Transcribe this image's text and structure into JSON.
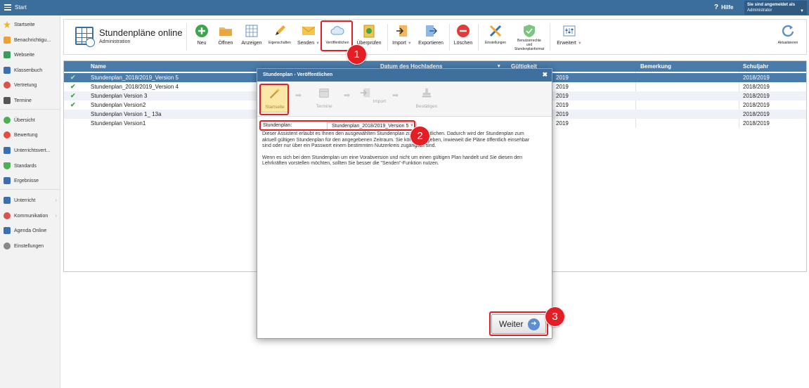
{
  "topbar": {
    "title": "Start",
    "help": "Hilfe",
    "user_line1": "Sie sind angemeldet als",
    "user_line2": "Administrator"
  },
  "sidebar": {
    "items": [
      {
        "label": "Startseite",
        "icon": "star-icon",
        "color": "#f0b429"
      },
      {
        "label": "Benachrichtigu...",
        "icon": "mail-icon",
        "color": "#f0a030"
      },
      {
        "label": "Webseite",
        "icon": "home-icon",
        "color": "#3a9a5c"
      },
      {
        "label": "Klassenbuch",
        "icon": "book-icon",
        "color": "#3a6fb0"
      },
      {
        "label": "Vertretung",
        "icon": "person-icon",
        "color": "#d9534f"
      },
      {
        "label": "Termine",
        "icon": "calendar-icon",
        "color": "#555"
      },
      {
        "label": "Übersicht",
        "icon": "check-circle-icon",
        "color": "#4caf50"
      },
      {
        "label": "Bewertung",
        "icon": "rating-icon",
        "color": "#e74c3c"
      },
      {
        "label": "Unterrichtsvert...",
        "icon": "list-icon",
        "color": "#3a6fb0"
      },
      {
        "label": "Standards",
        "icon": "shield-icon",
        "color": "#4caf50"
      },
      {
        "label": "Ergebnisse",
        "icon": "bar-chart-icon",
        "color": "#3a6fb0"
      },
      {
        "label": "Unterricht",
        "icon": "briefcase-icon",
        "color": "#3a6fb0"
      },
      {
        "label": "Kommunikation",
        "icon": "chat-icon",
        "color": "#d9534f"
      },
      {
        "label": "Agenda Online",
        "icon": "pen-icon",
        "color": "#3a6fb0"
      },
      {
        "label": "Einstellungen",
        "icon": "gear-icon",
        "color": "#888"
      }
    ]
  },
  "toolbar": {
    "app_title": "Stundenpläne online",
    "app_subtitle": "Administration",
    "neu": "Neu",
    "oeffnen": "Öffnen",
    "anzeigen": "Anzeigen",
    "eigenschaften": "Eigenschaften",
    "senden": "Senden",
    "veroeffentlichen": "Veröffentlichen",
    "ueberpruefen": "Überprüfen",
    "import": "Import",
    "exportieren": "Exportieren",
    "loeschen": "Löschen",
    "einstellungen": "Einstellungen",
    "benutzerrechte_1": "Benutzerrechte",
    "benutzerrechte_2": "und",
    "benutzerrechte_3": "Stundenplanformat",
    "erweitert": "Erweitert",
    "aktualisieren": "Aktualisieren"
  },
  "table": {
    "headers": {
      "name": "Name",
      "datum": "Datum des Hochladens",
      "gueltigkeit": "Gültigkeit",
      "bemerkung": "Bemerkung",
      "schuljahr": "Schuljahr"
    },
    "rows": [
      {
        "name": "Stundenplan_2018/2019_Version 5",
        "gueltigkeit": "2019",
        "schuljahr": "2018/2019",
        "checked": true
      },
      {
        "name": "Stundenplan_2018/2019_Version 4",
        "gueltigkeit": "2019",
        "schuljahr": "2018/2019",
        "checked": true
      },
      {
        "name": "Stundenplan Version 3",
        "gueltigkeit": "2019",
        "schuljahr": "2018/2019",
        "checked": true
      },
      {
        "name": "Stundenplan Version2",
        "gueltigkeit": "2019",
        "schuljahr": "2018/2019",
        "checked": true
      },
      {
        "name": "Stundenplan Version 1_ 13a",
        "gueltigkeit": "2019",
        "schuljahr": "2018/2019",
        "checked": false
      },
      {
        "name": "Stundenplan Version1",
        "gueltigkeit": "2019",
        "schuljahr": "2018/2019",
        "checked": false
      }
    ]
  },
  "modal": {
    "title": "Stundenplan - Veröffentlichen",
    "close": "✖",
    "steps": [
      "Startseite",
      "Termine",
      "Import",
      "Bestätigen"
    ],
    "field_label": "Stundenplan:",
    "field_value": "Stundenplan_2018/2019_Version 5",
    "desc_line1": "Dieser Assistent erlaubt es Ihnen den ausgewählten Stundenplan zu veröffentlichen. Dadurch wird der Stundenplan zum",
    "desc_line2": "aktuell gültigen Stundenplan für den angegebenen Zeitraum. Sie können angeben, inwieweit die Pläne öffentlich einsehbar",
    "desc_line3": "sind oder nur über ein Passwort einem bestimmten Nutzerkreis zugänglich sind.",
    "desc_line4": "Wenn es sich bei dem Stundenplan um eine Vorabversion und nicht um einen gültigen Plan handelt und Sie diesen den",
    "desc_line5": "Lehrkräften vorstellen möchten, sollten Sie besser die \"Senden\"-Funktion nutzen.",
    "next_button": "Weiter"
  },
  "annotations": {
    "badge1": "1",
    "badge2": "2",
    "badge3": "3"
  }
}
